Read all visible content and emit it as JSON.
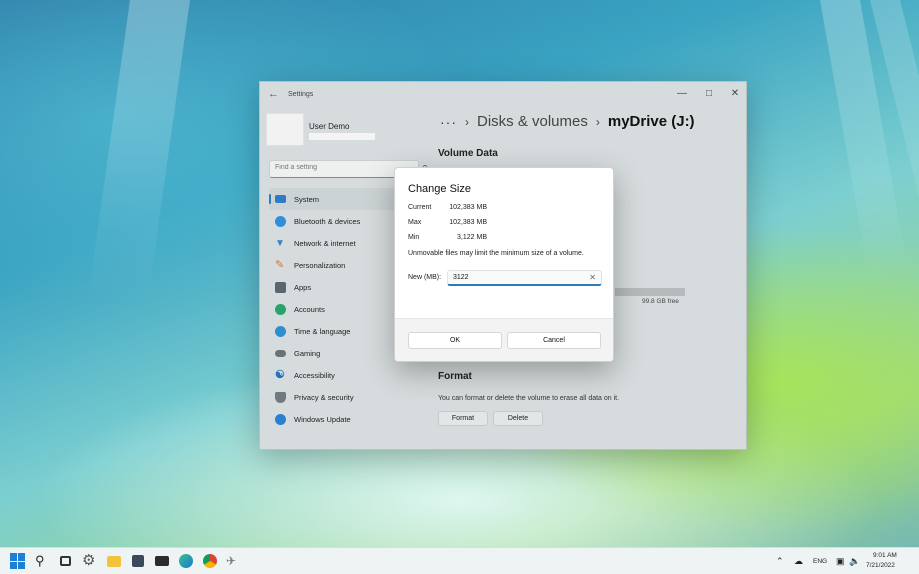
{
  "window": {
    "title": "Settings",
    "profile": {
      "name": "User Demo"
    },
    "search": {
      "placeholder": "Find a setting"
    },
    "nav": [
      {
        "label": "System",
        "icon": "display-icon",
        "color": "#2f79c9"
      },
      {
        "label": "Bluetooth & devices",
        "icon": "bluetooth-icon",
        "color": "#2f8fd8"
      },
      {
        "label": "Network & internet",
        "icon": "wifi-icon",
        "color": "#3a7fc8"
      },
      {
        "label": "Personalization",
        "icon": "brush-icon",
        "color": "#d9772a"
      },
      {
        "label": "Apps",
        "icon": "apps-icon",
        "color": "#5a6570"
      },
      {
        "label": "Accounts",
        "icon": "person-icon",
        "color": "#28a36b"
      },
      {
        "label": "Time & language",
        "icon": "globe-icon",
        "color": "#2e8fcf"
      },
      {
        "label": "Gaming",
        "icon": "gamepad-icon",
        "color": "#6b7277"
      },
      {
        "label": "Accessibility",
        "icon": "accessibility-icon",
        "color": "#1f6fbf"
      },
      {
        "label": "Privacy & security",
        "icon": "shield-icon",
        "color": "#707880"
      },
      {
        "label": "Windows Update",
        "icon": "update-icon",
        "color": "#2b7fd0"
      }
    ],
    "breadcrumb": {
      "dots": "···",
      "parent": "Disks & volumes",
      "current": "myDrive (J:)"
    },
    "volume_data": {
      "title": "Volume Data",
      "free": "99.8 GB free"
    },
    "format": {
      "title": "Format",
      "description": "You can format or delete the volume to erase all data on it.",
      "format_button": "Format",
      "delete_button": "Delete"
    }
  },
  "dialog": {
    "title": "Change Size",
    "current_label": "Current",
    "current_value": "102,383 MB",
    "max_label": "Max",
    "max_value": "102,383 MB",
    "min_label": "Min",
    "min_value": "3,122 MB",
    "note": "Unmovable files may limit the minimum size of a volume.",
    "new_label": "New (MB):",
    "new_value": "3122",
    "ok_label": "OK",
    "cancel_label": "Cancel"
  },
  "tray": {
    "language": "ENG",
    "time": "9:01 AM",
    "date": "7/21/2022"
  },
  "colors": {
    "accent": "#2b7bb9"
  }
}
